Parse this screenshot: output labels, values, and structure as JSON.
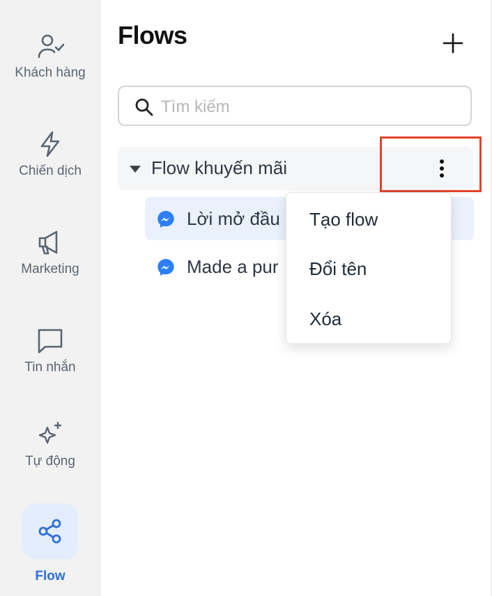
{
  "sidebar": {
    "items": [
      {
        "label": "Khách hàng",
        "icon": "user-check-icon"
      },
      {
        "label": "Chiến dịch",
        "icon": "lightning-icon"
      },
      {
        "label": "Marketing",
        "icon": "megaphone-icon"
      },
      {
        "label": "Tin nhắn",
        "icon": "message-square-icon"
      },
      {
        "label": "Tự động",
        "icon": "sparkles-icon"
      },
      {
        "label": "Flow",
        "icon": "share-nodes-icon",
        "active": true
      }
    ]
  },
  "main": {
    "title": "Flows",
    "search": {
      "placeholder": "Tìm kiếm",
      "value": ""
    },
    "folder": {
      "name": "Flow khuyến mãi",
      "expanded": true
    },
    "flows": [
      {
        "name": "Lời mở đầu",
        "icon": "messenger-icon",
        "selected": true
      },
      {
        "name": "Made a pur",
        "icon": "messenger-icon",
        "selected": false
      }
    ],
    "context_menu": {
      "items": [
        "Tạo flow",
        "Đổi tên",
        "Xóa"
      ]
    }
  },
  "colors": {
    "accent": "#2f6fdb",
    "active_bg": "#e4edfb",
    "highlight": "#e2432b",
    "messenger": "#2d7ff9"
  }
}
